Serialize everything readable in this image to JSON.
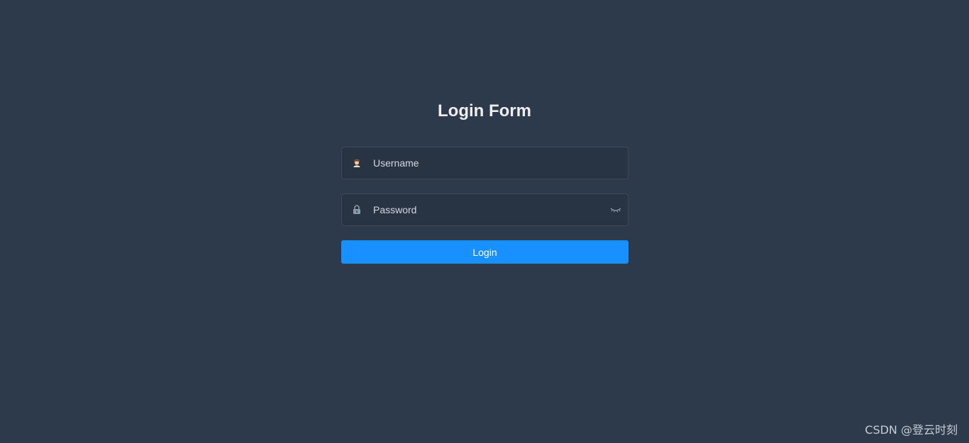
{
  "form": {
    "title": "Login Form",
    "username": {
      "placeholder": "Username",
      "value": "",
      "icon": "user-avatar-icon"
    },
    "password": {
      "placeholder": "Password",
      "value": "",
      "icon": "lock-icon",
      "toggle_icon": "eye-closed-icon"
    },
    "submit_label": "Login"
  },
  "watermark": "CSDN @登云时刻",
  "colors": {
    "background": "#2d3a4b",
    "input_background": "#283443",
    "accent": "#1890ff",
    "title": "#eeeeee"
  }
}
